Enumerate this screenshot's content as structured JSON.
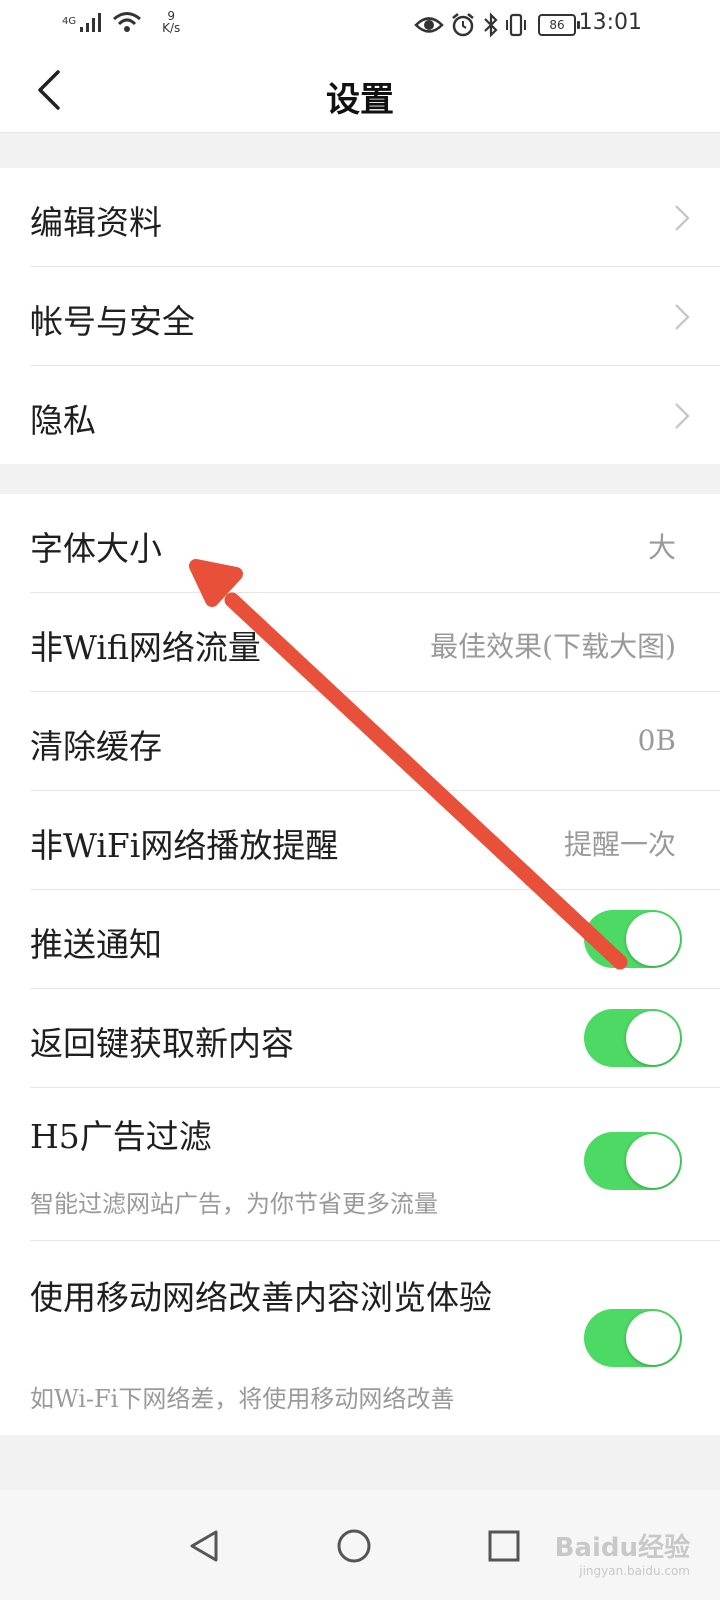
{
  "status_bar": {
    "network": "4G",
    "speed_value": "9",
    "speed_unit": "K/s",
    "battery": "86",
    "time": "13:01"
  },
  "header": {
    "title": "设置",
    "back_icon": "chevron-left-icon"
  },
  "group1": [
    {
      "label": "编辑资料"
    },
    {
      "label": "帐号与安全"
    },
    {
      "label": "隐私"
    }
  ],
  "group2": [
    {
      "label": "字体大小",
      "value": "大"
    },
    {
      "label": "非Wifi网络流量",
      "value": "最佳效果(下载大图)"
    },
    {
      "label": "清除缓存",
      "value": "0B"
    },
    {
      "label": "非WiFi网络播放提醒",
      "value": "提醒一次"
    },
    {
      "label": "推送通知",
      "toggle": true
    },
    {
      "label": "返回键获取新内容",
      "toggle": true
    },
    {
      "label": "H5广告过滤",
      "sub": "智能过滤网站广告，为你节省更多流量",
      "toggle": true
    },
    {
      "label": "使用移动网络改善内容浏览体验",
      "sub": "如Wi-Fi下网络差，将使用移动网络改善",
      "toggle": true
    }
  ],
  "colors": {
    "toggle_on": "#4cd964",
    "annotation_arrow": "#e8503a"
  },
  "watermark": {
    "main": "Baidu经验",
    "sub": "jingyan.baidu.com"
  }
}
